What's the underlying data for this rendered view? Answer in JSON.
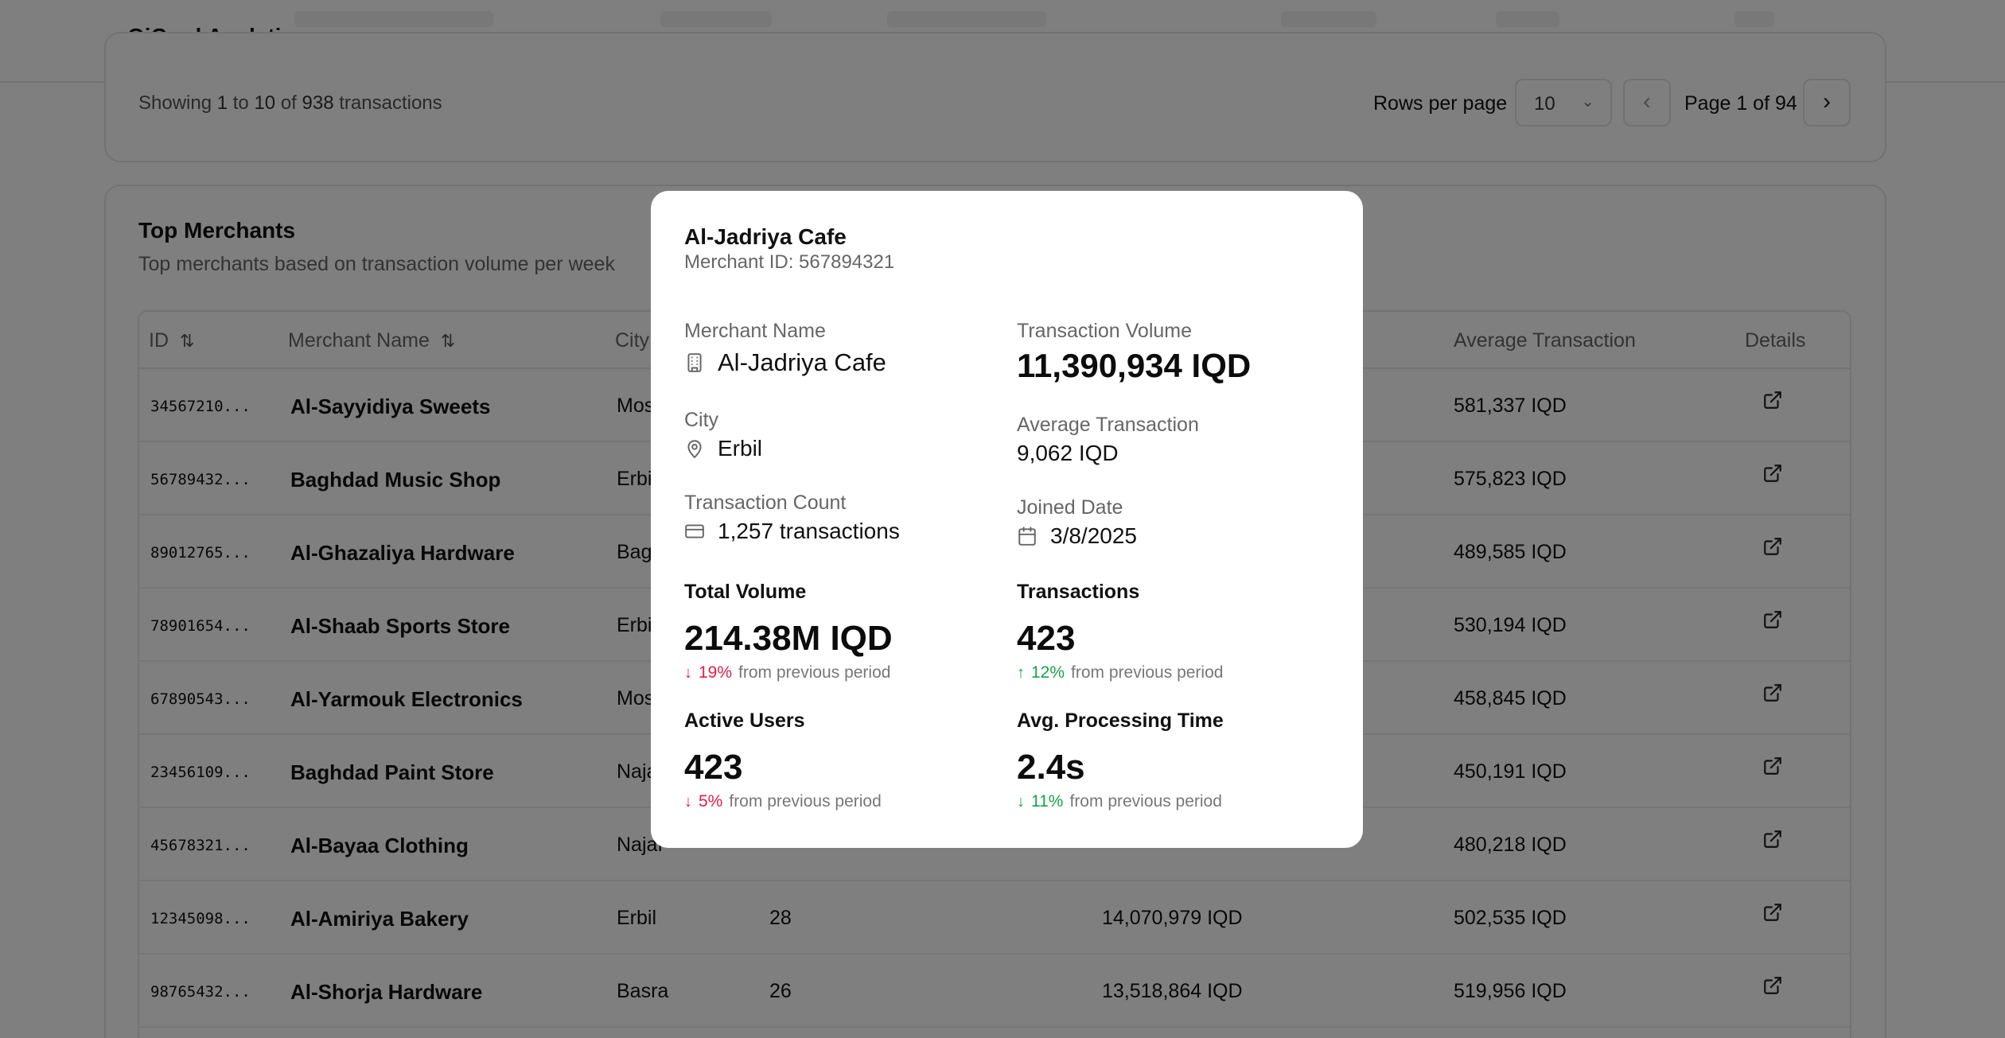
{
  "app": {
    "title": "QiCard Analytics"
  },
  "pagination": {
    "showing_prefix": "Showing",
    "from": "1",
    "to_word": "to",
    "to": "10",
    "of_word": "of",
    "total": "938",
    "suffix": "transactions",
    "rows_per_page_label": "Rows per page",
    "rows_per_page_value": "10",
    "page_label": "Page 1 of 94"
  },
  "top_merchants": {
    "title": "Top Merchants",
    "subtitle": "Top merchants based on transaction volume per week",
    "columns": {
      "id": "ID",
      "name": "Merchant Name",
      "city": "City",
      "count": "",
      "volume": "",
      "avg": "Average Transaction",
      "details": "Details"
    },
    "rows": [
      {
        "id": "34567210...",
        "name": "Al-Sayyidiya Sweets",
        "city": "Mos",
        "count": "",
        "volume": "",
        "avg": "581,337 IQD"
      },
      {
        "id": "56789432...",
        "name": "Baghdad Music Shop",
        "city": "Erbi",
        "count": "",
        "volume": "",
        "avg": "575,823 IQD"
      },
      {
        "id": "89012765...",
        "name": "Al-Ghazaliya Hardware",
        "city": "Bag",
        "count": "",
        "volume": "",
        "avg": "489,585 IQD"
      },
      {
        "id": "78901654...",
        "name": "Al-Shaab Sports Store",
        "city": "Erbi",
        "count": "",
        "volume": "",
        "avg": "530,194 IQD"
      },
      {
        "id": "67890543...",
        "name": "Al-Yarmouk Electronics",
        "city": "Mos",
        "count": "",
        "volume": "",
        "avg": "458,845 IQD"
      },
      {
        "id": "23456109...",
        "name": "Baghdad Paint Store",
        "city": "Naja",
        "count": "",
        "volume": "",
        "avg": "450,191 IQD"
      },
      {
        "id": "45678321...",
        "name": "Al-Bayaa Clothing",
        "city": "Najaf",
        "count": "",
        "volume": "",
        "avg": "480,218 IQD"
      },
      {
        "id": "12345098...",
        "name": "Al-Amiriya Bakery",
        "city": "Erbil",
        "count": "28",
        "volume": "14,070,979 IQD",
        "avg": "502,535 IQD"
      },
      {
        "id": "98765432...",
        "name": "Al-Shorja Hardware",
        "city": "Basra",
        "count": "26",
        "volume": "13,518,864 IQD",
        "avg": "519,956 IQD"
      }
    ]
  },
  "dialog": {
    "title": "Al-Jadriya Cafe",
    "merchant_id": "Merchant ID: 567894321",
    "merchant_name_label": "Merchant Name",
    "merchant_name": "Al-Jadriya Cafe",
    "city_label": "City",
    "city": "Erbil",
    "count_label": "Transaction Count",
    "count": "1,257 transactions",
    "volume_label": "Transaction Volume",
    "volume": "11,390,934 IQD",
    "avg_label": "Average Transaction",
    "avg": "9,062 IQD",
    "joined_label": "Joined Date",
    "joined": "3/8/2025",
    "stats": {
      "total_volume": {
        "label": "Total Volume",
        "value": "214.38M IQD",
        "pct": "19%",
        "text": "from previous period",
        "direction": "down"
      },
      "transactions": {
        "label": "Transactions",
        "value": "423",
        "pct": "12%",
        "text": "from previous period",
        "direction": "up"
      },
      "active_users": {
        "label": "Active Users",
        "value": "423",
        "pct": "5%",
        "text": "from previous period",
        "direction": "down"
      },
      "processing": {
        "label": "Avg. Processing Time",
        "value": "2.4s",
        "pct": "11%",
        "text": "from previous period",
        "direction": "down"
      }
    }
  },
  "colors": {
    "overlay": "#00000080",
    "negative": "#e11d48",
    "positive": "#16a34a"
  },
  "icons": [
    "building-icon",
    "map-pin-icon",
    "credit-card-icon",
    "calendar-icon",
    "external-link-icon",
    "arrow-down-icon",
    "arrow-up-icon",
    "sort-icon",
    "chevron-down-icon",
    "chevron-left-icon",
    "chevron-right-icon"
  ]
}
